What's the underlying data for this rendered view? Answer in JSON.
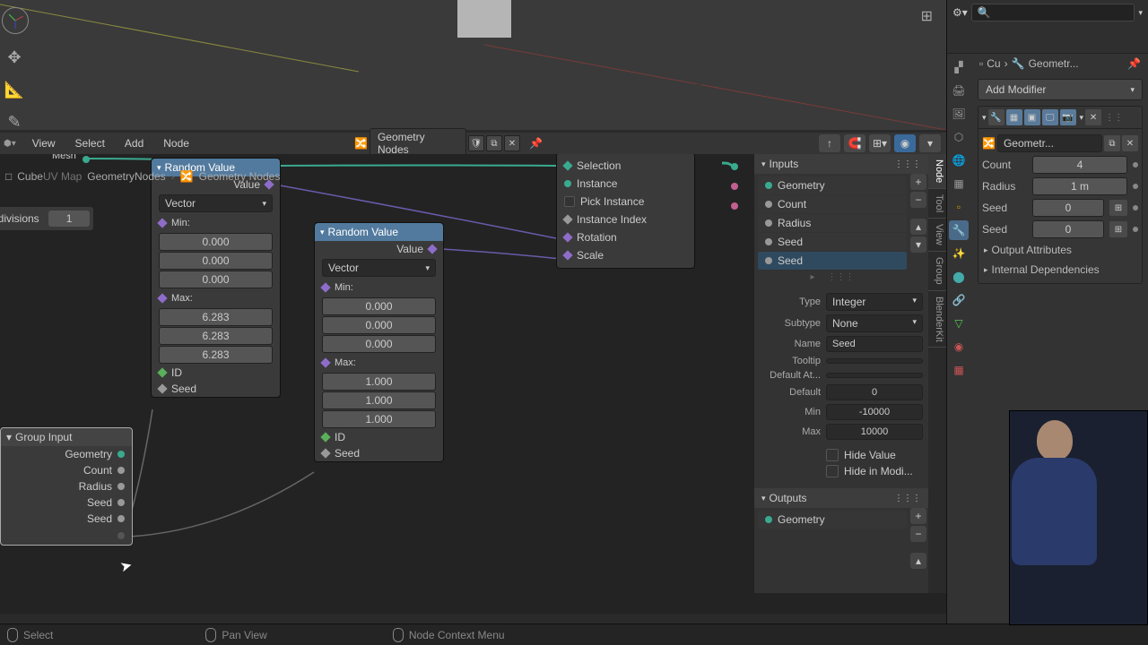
{
  "viewport": {
    "grid_icon": "⊞"
  },
  "node_header": {
    "menus": [
      "View",
      "Select",
      "Add",
      "Node"
    ],
    "tree_name": "Geometry Nodes",
    "pin_icon": "📌"
  },
  "breadcrumb": {
    "obj_icon": "□",
    "object": "Cube",
    "uvmap": "UV Map",
    "tree": "GeometryNodes",
    "sep": "›",
    "subtree": "Geometry Nodes"
  },
  "subdivisions": {
    "label": "idivisions",
    "value": "1"
  },
  "mesh_label": "Mesh",
  "nodes": {
    "random1": {
      "title": "Random Value",
      "value_out": "Value",
      "dtype": "Vector",
      "min_label": "Min:",
      "min": [
        "0.000",
        "0.000",
        "0.000"
      ],
      "max_label": "Max:",
      "max": [
        "6.283",
        "6.283",
        "6.283"
      ],
      "id": "ID",
      "seed": "Seed"
    },
    "random2": {
      "title": "Random Value",
      "value_out": "Value",
      "dtype": "Vector",
      "min_label": "Min:",
      "min": [
        "0.000",
        "0.000",
        "0.000"
      ],
      "max_label": "Max:",
      "max": [
        "1.000",
        "1.000",
        "1.000"
      ],
      "id": "ID",
      "seed": "Seed"
    },
    "group_input": {
      "title": "Group Input",
      "outputs": [
        "Geometry",
        "Count",
        "Radius",
        "Seed",
        "Seed"
      ]
    },
    "instance": {
      "rows": [
        "Selection",
        "Instance",
        "Pick Instance",
        "Instance Index",
        "Rotation",
        "Scale"
      ]
    }
  },
  "n_panel": {
    "inputs_hdr": "Inputs",
    "items": [
      {
        "label": "Geometry",
        "color": "s-teal"
      },
      {
        "label": "Count",
        "color": "s-gray"
      },
      {
        "label": "Radius",
        "color": "s-gray"
      },
      {
        "label": "Seed",
        "color": "s-gray"
      },
      {
        "label": "Seed",
        "color": "s-gray",
        "selected": true
      }
    ],
    "fields": {
      "type_l": "Type",
      "type_v": "Integer",
      "subtype_l": "Subtype",
      "subtype_v": "None",
      "name_l": "Name",
      "name_v": "Seed",
      "tooltip_l": "Tooltip",
      "tooltip_v": "",
      "defattr_l": "Default At...",
      "defattr_v": "",
      "default_l": "Default",
      "default_v": "0",
      "min_l": "Min",
      "min_v": "-10000",
      "max_l": "Max",
      "max_v": "10000"
    },
    "checks": {
      "hide_value": "Hide Value",
      "hide_mod": "Hide in Modi..."
    },
    "outputs_hdr": "Outputs",
    "out_item": "Geometry"
  },
  "vert_tabs": [
    "Node",
    "Tool",
    "View",
    "Group",
    "BlenderKit"
  ],
  "props": {
    "bc_obj": "Cu",
    "bc_sep": "›",
    "bc_mod": "Geometr...",
    "add_modifier": "Add Modifier",
    "mod": {
      "tree_name": "Geometr...",
      "inputs": {
        "count_l": "Count",
        "count_v": "4",
        "radius_l": "Radius",
        "radius_v": "1 m",
        "seed1_l": "Seed",
        "seed1_v": "0",
        "seed2_l": "Seed",
        "seed2_v": "0"
      },
      "sections": {
        "out_attr": "Output Attributes",
        "int_dep": "Internal Dependencies"
      }
    }
  },
  "status": {
    "select": "Select",
    "pan": "Pan View",
    "context": "Node Context Menu"
  }
}
